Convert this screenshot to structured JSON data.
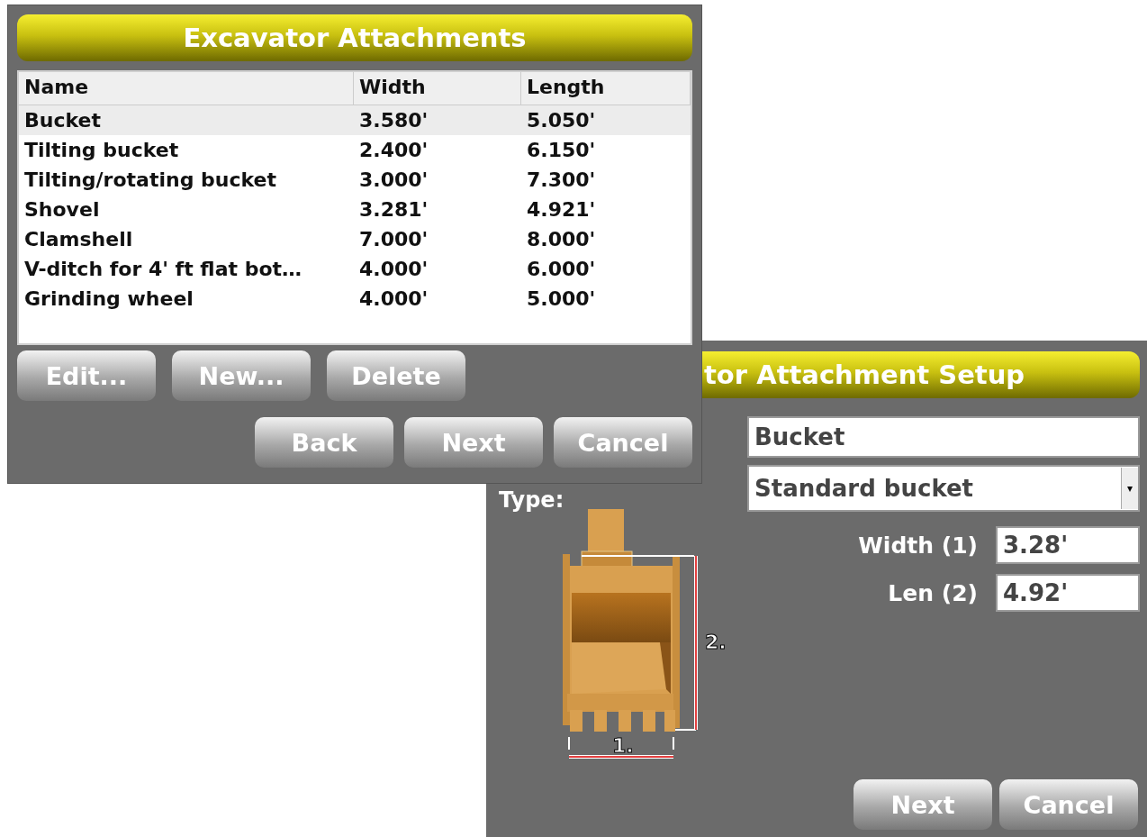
{
  "attachments_window": {
    "title": "Excavator Attachments",
    "columns": [
      "Name",
      "Width",
      "Length"
    ],
    "rows": [
      {
        "name": "Bucket",
        "width": "3.580'",
        "length": "5.050'",
        "selected": true
      },
      {
        "name": "Tilting bucket",
        "width": "2.400'",
        "length": "6.150'",
        "selected": false
      },
      {
        "name": "Tilting/rotating bucket",
        "width": "3.000'",
        "length": "7.300'",
        "selected": false
      },
      {
        "name": "Shovel",
        "width": "3.281'",
        "length": "4.921'",
        "selected": false
      },
      {
        "name": "Clamshell",
        "width": "7.000'",
        "length": "8.000'",
        "selected": false
      },
      {
        "name": "V-ditch for 4' ft flat bot…",
        "width": "4.000'",
        "length": "6.000'",
        "selected": false
      },
      {
        "name": "Grinding wheel",
        "width": "4.000'",
        "length": "5.000'",
        "selected": false
      }
    ],
    "list_buttons": [
      "Edit...",
      "New...",
      "Delete"
    ],
    "nav_buttons": [
      "Back",
      "Next",
      "Cancel"
    ]
  },
  "setup_window": {
    "title": "tor Attachment Setup",
    "name_field": {
      "value": "Bucket"
    },
    "type_label": "Type:",
    "type_dropdown": {
      "value": "Standard bucket",
      "arrow": "▾"
    },
    "width": {
      "label": "Width (1)",
      "value": "3.28'"
    },
    "length": {
      "label": "Len (2)",
      "value": "4.92'"
    },
    "width_marker": "1.",
    "length_marker": "2.",
    "buttons": [
      "Next",
      "Cancel"
    ]
  }
}
